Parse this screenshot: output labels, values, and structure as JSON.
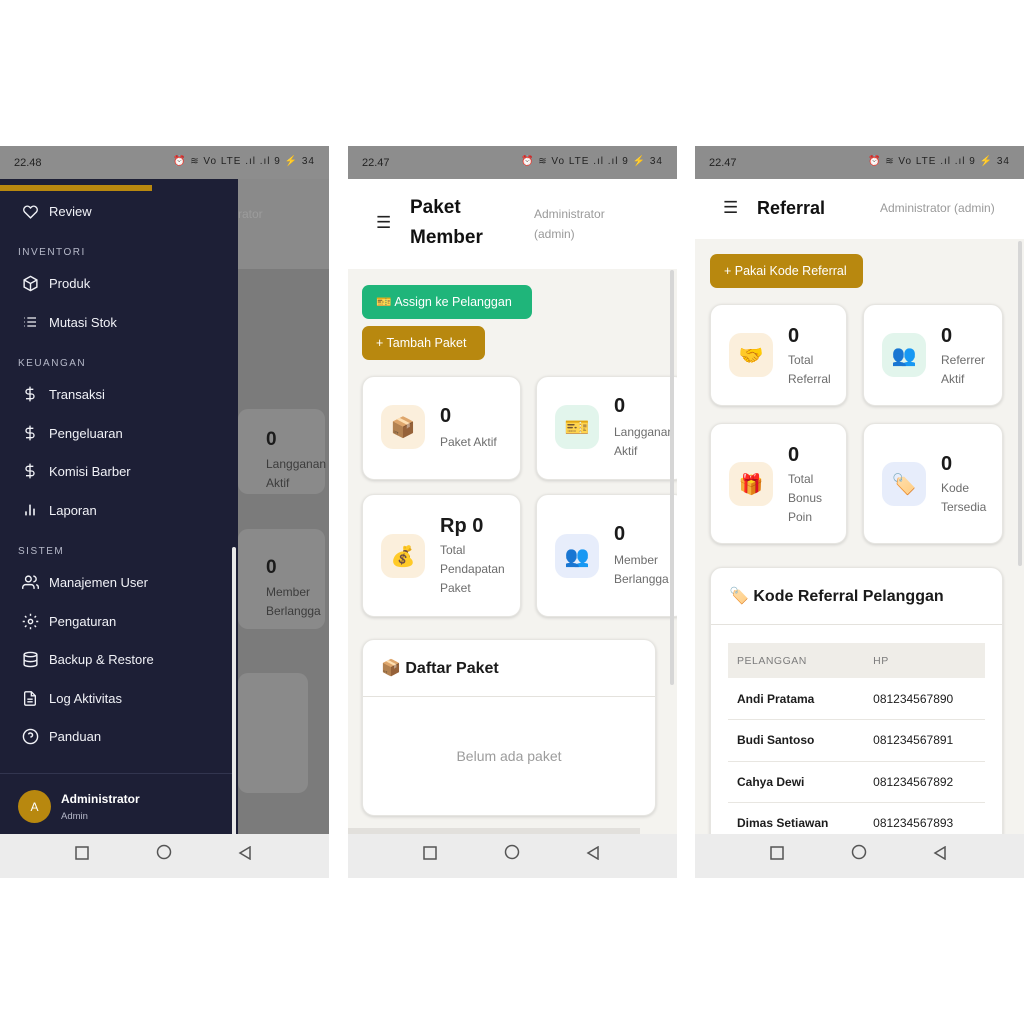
{
  "status": {
    "p1_time": "22.48",
    "p2_time": "22.47",
    "p3_time": "22.47",
    "icons": "⏰ ≋ Vo LTE .ıl .ıl 9 ⚡ 34",
    "battery": "34"
  },
  "drawer": {
    "review": "Review",
    "section_inventori": "INVENTORI",
    "produk": "Produk",
    "mutasi": "Mutasi Stok",
    "section_keuangan": "KEUANGAN",
    "transaksi": "Transaksi",
    "pengeluaran": "Pengeluaran",
    "komisi": "Komisi Barber",
    "laporan": "Laporan",
    "section_sistem": "SISTEM",
    "manajemen": "Manajemen User",
    "pengaturan": "Pengaturan",
    "backup": "Backup & Restore",
    "log": "Log Aktivitas",
    "panduan": "Panduan",
    "avatar_initial": "A",
    "user_name": "Administrator",
    "user_role": "Admin"
  },
  "underlay": {
    "header_text": "rator",
    "card1_num": "0",
    "card1_label1": "Langganan",
    "card1_label2": "Aktif",
    "card2_num": "0",
    "card2_label1": "Member",
    "card2_label2": "Berlangga"
  },
  "paket": {
    "title_line1": "Paket",
    "title_line2": "Member",
    "user_line1": "Administrator",
    "user_line2": "(admin)",
    "assign_btn": "🎫 Assign ke Pelanggan",
    "tambah_btn": "+ Tambah Paket",
    "stats": [
      {
        "icon": "📦",
        "value": "0",
        "label": [
          "Paket Aktif"
        ]
      },
      {
        "icon": "🎫",
        "value": "0",
        "label": [
          "Langganan",
          "Aktif"
        ]
      },
      {
        "icon": "💰",
        "value": "Rp 0",
        "label": [
          "Total",
          "Pendapatan",
          "Paket"
        ]
      },
      {
        "icon": "👥",
        "value": "0",
        "label": [
          "Member",
          "Berlangga"
        ]
      }
    ],
    "list_title": "📦 Daftar Paket",
    "empty_text": "Belum ada paket"
  },
  "referral": {
    "title": "Referral",
    "user": "Administrator (admin)",
    "pakai_btn": "+ Pakai Kode Referral",
    "stats": [
      {
        "icon": "🤝",
        "value": "0",
        "label": [
          "Total",
          "Referral"
        ]
      },
      {
        "icon": "👥",
        "value": "0",
        "label": [
          "Referrer",
          "Aktif"
        ]
      },
      {
        "icon": "🎁",
        "value": "0",
        "label": [
          "Total",
          "Bonus",
          "Poin"
        ]
      },
      {
        "icon": "🏷️",
        "value": "0",
        "label": [
          "Kode",
          "Tersedia"
        ]
      }
    ],
    "section_title": "🏷️ Kode Referral Pelanggan",
    "columns": [
      "PELANGGAN",
      "HP"
    ],
    "rows": [
      [
        "Andi Pratama",
        "081234567890"
      ],
      [
        "Budi Santoso",
        "081234567891"
      ],
      [
        "Cahya Dewi",
        "081234567892"
      ],
      [
        "Dimas Setiawan",
        "081234567893"
      ]
    ]
  },
  "colors": {
    "gold": "#b8880f",
    "green": "#1fb57a",
    "drawer_bg": "#1d1f36"
  }
}
